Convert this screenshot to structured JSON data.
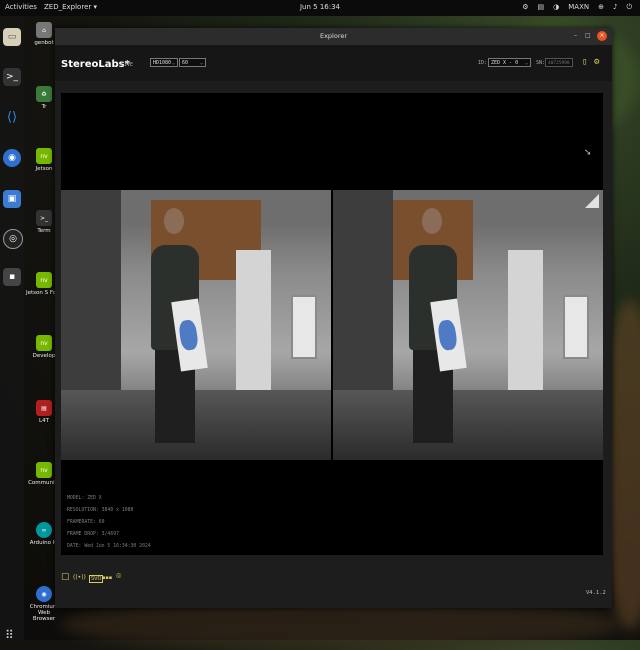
{
  "topbar": {
    "activities": "Activities",
    "app_menu": "ZED_Explorer ▾",
    "clock": "Jun 5  16:34",
    "tray": [
      "⚙",
      "▤",
      "◑",
      "MAXN",
      "⊕",
      "♪",
      "⏻"
    ]
  },
  "dock": {
    "items": [
      "files-icon",
      "terminal-icon",
      "vscode-icon",
      "chromium-icon",
      "screenshot-icon",
      "obs-icon",
      "app-icon"
    ],
    "grid_icon": "⠿"
  },
  "desktop": {
    "icons": [
      {
        "label": "genbot",
        "icon": "home-icon"
      },
      {
        "label": "Tr",
        "icon": "trash-icon"
      },
      {
        "label": "Jetson",
        "icon": "nvidia-icon"
      },
      {
        "label": "Term",
        "icon": "terminal-icon"
      },
      {
        "label": "Jetson S Foru",
        "icon": "nvidia-icon"
      },
      {
        "label": "Develop",
        "icon": "nvidia-icon"
      },
      {
        "label": "L4T",
        "icon": "doc-icon"
      },
      {
        "label": "Community",
        "icon": "nvidia-icon"
      },
      {
        "label": "Arduino IC",
        "icon": "arduino-icon"
      },
      {
        "label": "Chromium Web Browser",
        "icon": "chromium-icon"
      }
    ]
  },
  "window": {
    "title": "Explorer",
    "minimize": "–",
    "maximize": "□",
    "close": "×"
  },
  "toolbar": {
    "logo": "StereoLabs*",
    "live": "LIVE",
    "resolution": "HD1080",
    "fps": "60",
    "id_label": "ID:",
    "camera_select": "ZED X - 0",
    "sn_label": "SN:",
    "sn_value": "40725998",
    "icons": [
      "record-icon",
      "settings-icon"
    ]
  },
  "info": {
    "lines": [
      "MODEL: ZED X",
      "RESOLUTION: 3840 x 1080",
      "FRAMERATE: 60",
      "FRAME DROP: 3/4697",
      "DATE: Wed Jun 5 16:34:30 2024"
    ]
  },
  "bottombar": {
    "icons": [
      "folder-icon",
      "stream-icon",
      "svo-icon",
      "sensors-icon",
      "camera-icon"
    ],
    "icon_glyphs": [
      "▢",
      "((•))",
      "SVO",
      "▪▪▪",
      "⌾"
    ],
    "version": "V4.1.2"
  },
  "colors": {
    "accent": "#d9cc63",
    "close": "#e95420"
  }
}
